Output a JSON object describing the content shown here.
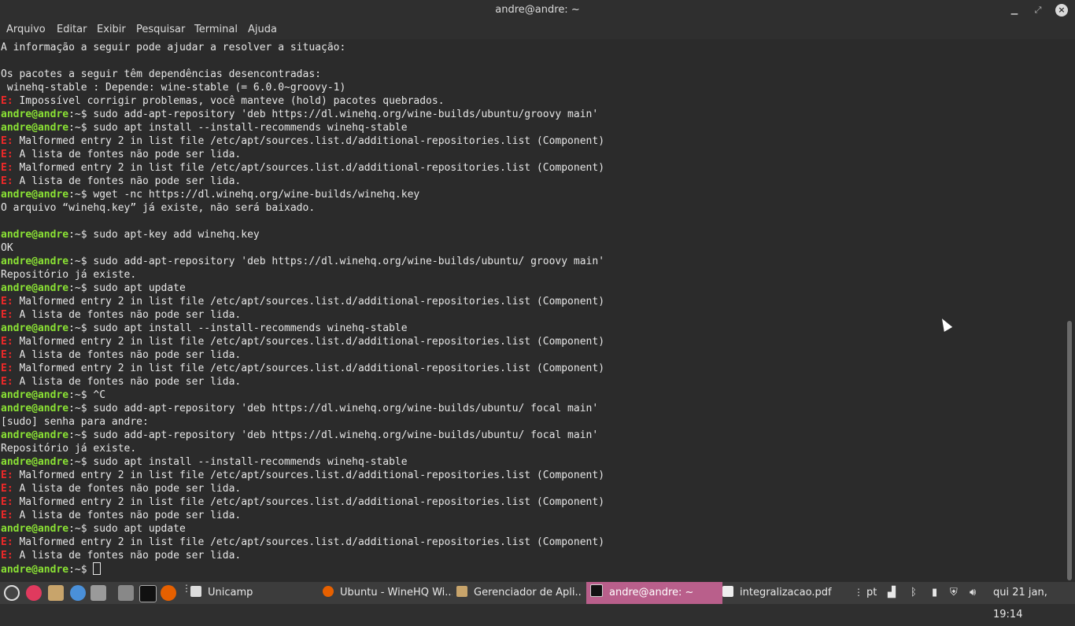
{
  "window": {
    "title": "andre@andre: ~"
  },
  "menu": {
    "items": [
      "Arquivo",
      "Editar",
      "Exibir",
      "Pesquisar",
      "Terminal",
      "Ajuda"
    ]
  },
  "terminal": {
    "lines": [
      {
        "type": "text",
        "text": "A informação a seguir pode ajudar a resolver a situação:"
      },
      {
        "type": "text",
        "text": ""
      },
      {
        "type": "text",
        "text": "Os pacotes a seguir têm dependências desencontradas:"
      },
      {
        "type": "text",
        "text": " winehq-stable : Depende: wine-stable (= 6.0.0~groovy-1)"
      },
      {
        "type": "err",
        "label": "E:",
        "text": " Impossível corrigir problemas, você manteve (hold) pacotes quebrados."
      },
      {
        "type": "prompt",
        "user": "andre@andre",
        "path": ":~$",
        "text": " sudo add-apt-repository 'deb https://dl.winehq.org/wine-builds/ubuntu/groovy main'"
      },
      {
        "type": "prompt",
        "user": "andre@andre",
        "path": ":~$",
        "text": " sudo apt install --install-recommends winehq-stable"
      },
      {
        "type": "err",
        "label": "E:",
        "text": " Malformed entry 2 in list file /etc/apt/sources.list.d/additional-repositories.list (Component)"
      },
      {
        "type": "err",
        "label": "E:",
        "text": " A lista de fontes não pode ser lida."
      },
      {
        "type": "err",
        "label": "E:",
        "text": " Malformed entry 2 in list file /etc/apt/sources.list.d/additional-repositories.list (Component)"
      },
      {
        "type": "err",
        "label": "E:",
        "text": " A lista de fontes não pode ser lida."
      },
      {
        "type": "prompt",
        "user": "andre@andre",
        "path": ":~$",
        "text": " wget -nc https://dl.winehq.org/wine-builds/winehq.key"
      },
      {
        "type": "text",
        "text": "O arquivo “winehq.key” já existe, não será baixado."
      },
      {
        "type": "text",
        "text": ""
      },
      {
        "type": "prompt",
        "user": "andre@andre",
        "path": ":~$",
        "text": " sudo apt-key add winehq.key"
      },
      {
        "type": "text",
        "text": "OK"
      },
      {
        "type": "prompt",
        "user": "andre@andre",
        "path": ":~$",
        "text": " sudo add-apt-repository 'deb https://dl.winehq.org/wine-builds/ubuntu/ groovy main'"
      },
      {
        "type": "text",
        "text": "Repositório já existe."
      },
      {
        "type": "prompt",
        "user": "andre@andre",
        "path": ":~$",
        "text": " sudo apt update"
      },
      {
        "type": "err",
        "label": "E:",
        "text": " Malformed entry 2 in list file /etc/apt/sources.list.d/additional-repositories.list (Component)"
      },
      {
        "type": "err",
        "label": "E:",
        "text": " A lista de fontes não pode ser lida."
      },
      {
        "type": "prompt",
        "user": "andre@andre",
        "path": ":~$",
        "text": " sudo apt install --install-recommends winehq-stable"
      },
      {
        "type": "err",
        "label": "E:",
        "text": " Malformed entry 2 in list file /etc/apt/sources.list.d/additional-repositories.list (Component)"
      },
      {
        "type": "err",
        "label": "E:",
        "text": " A lista de fontes não pode ser lida."
      },
      {
        "type": "err",
        "label": "E:",
        "text": " Malformed entry 2 in list file /etc/apt/sources.list.d/additional-repositories.list (Component)"
      },
      {
        "type": "err",
        "label": "E:",
        "text": " A lista de fontes não pode ser lida."
      },
      {
        "type": "prompt",
        "user": "andre@andre",
        "path": ":~$",
        "text": " ^C"
      },
      {
        "type": "prompt",
        "user": "andre@andre",
        "path": ":~$",
        "text": " sudo add-apt-repository 'deb https://dl.winehq.org/wine-builds/ubuntu/ focal main'"
      },
      {
        "type": "text",
        "text": "[sudo] senha para andre:"
      },
      {
        "type": "prompt",
        "user": "andre@andre",
        "path": ":~$",
        "text": " sudo add-apt-repository 'deb https://dl.winehq.org/wine-builds/ubuntu/ focal main'"
      },
      {
        "type": "text",
        "text": "Repositório já existe."
      },
      {
        "type": "prompt",
        "user": "andre@andre",
        "path": ":~$",
        "text": " sudo apt install --install-recommends winehq-stable"
      },
      {
        "type": "err",
        "label": "E:",
        "text": " Malformed entry 2 in list file /etc/apt/sources.list.d/additional-repositories.list (Component)"
      },
      {
        "type": "err",
        "label": "E:",
        "text": " A lista de fontes não pode ser lida."
      },
      {
        "type": "err",
        "label": "E:",
        "text": " Malformed entry 2 in list file /etc/apt/sources.list.d/additional-repositories.list (Component)"
      },
      {
        "type": "err",
        "label": "E:",
        "text": " A lista de fontes não pode ser lida."
      },
      {
        "type": "prompt",
        "user": "andre@andre",
        "path": ":~$",
        "text": " sudo apt update"
      },
      {
        "type": "err",
        "label": "E:",
        "text": " Malformed entry 2 in list file /etc/apt/sources.list.d/additional-repositories.list (Component)"
      },
      {
        "type": "err",
        "label": "E:",
        "text": " A lista de fontes não pode ser lida."
      },
      {
        "type": "cursor",
        "user": "andre@andre",
        "path": ":~$",
        "text": " "
      }
    ]
  },
  "taskbar": {
    "places_label": "Unicamp",
    "windows": [
      {
        "label": "Ubuntu - WineHQ Wi...",
        "icon": "firefox-icon"
      },
      {
        "label": "Gerenciador de Apli...",
        "icon": "package-manager-icon"
      },
      {
        "label": "andre@andre: ~",
        "icon": "terminal-icon",
        "active": true
      },
      {
        "label": "integralizacao.pdf",
        "icon": "document-icon"
      }
    ],
    "keyboard_layout": "pt",
    "clock": "qui 21 jan, 19:14"
  },
  "colors": {
    "accent": "#b95f8b",
    "prompt": "#8ae234",
    "error": "#ef2929"
  }
}
